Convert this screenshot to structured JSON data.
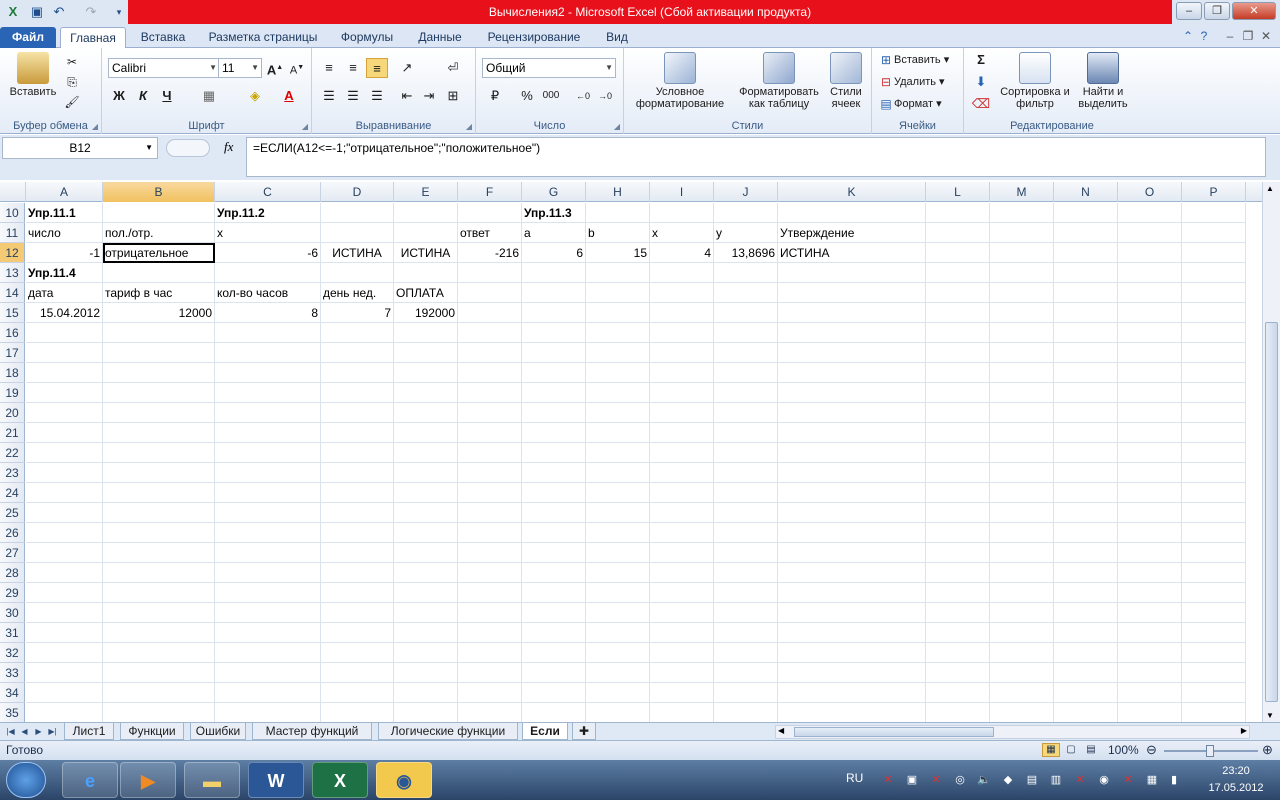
{
  "window": {
    "title": "Вычисления2 - Microsoft Excel (Сбой активации продукта)"
  },
  "ribbon_tabs": [
    "Файл",
    "Главная",
    "Вставка",
    "Разметка страницы",
    "Формулы",
    "Данные",
    "Рецензирование",
    "Вид"
  ],
  "ribbon": {
    "clipboard": {
      "paste": "Вставить",
      "label": "Буфер обмена"
    },
    "font": {
      "name": "Calibri",
      "size": "11",
      "label": "Шрифт",
      "bold": "Ж",
      "italic": "К",
      "underline": "Ч"
    },
    "alignment": {
      "label": "Выравнивание"
    },
    "number": {
      "format": "Общий",
      "label": "Число",
      "percent": "%",
      "thousands": "000"
    },
    "styles": {
      "conditional": "Условное форматирование",
      "table": "Форматировать как таблицу",
      "cell_styles": "Стили ячеек",
      "label": "Стили"
    },
    "cells": {
      "insert": "Вставить",
      "delete": "Удалить",
      "format": "Формат",
      "label": "Ячейки"
    },
    "editing": {
      "sort": "Сортировка и фильтр",
      "find": "Найти и выделить",
      "label": "Редактирование"
    }
  },
  "formula_bar": {
    "name_box": "B12",
    "fx": "fx",
    "formula": "=ЕСЛИ(A12<=-1;\"отрицательное\";\"положительное\")"
  },
  "columns": [
    "A",
    "B",
    "C",
    "D",
    "E",
    "F",
    "G",
    "H",
    "I",
    "J",
    "K",
    "L",
    "M",
    "N",
    "O",
    "P"
  ],
  "rows": {
    "r10": {
      "num": "10",
      "A": "Упр.11.1",
      "C": "Упр.11.2",
      "G": "Упр.11.3"
    },
    "r11": {
      "num": "11",
      "A": "число",
      "B": "пол./отр.",
      "C": "x",
      "F": "ответ",
      "G": "a",
      "H": "b",
      "I": "x",
      "J": "y",
      "K": "Утверждение"
    },
    "r12": {
      "num": "12",
      "A": "-1",
      "B": "отрицательное",
      "C": "-6",
      "D": "ИСТИНА",
      "E": "ИСТИНА",
      "F": "-216",
      "G": "6",
      "H": "15",
      "I": "4",
      "J": "13,8696",
      "K": "ИСТИНА"
    },
    "r13": {
      "num": "13",
      "A": "Упр.11.4"
    },
    "r14": {
      "num": "14",
      "A": "дата",
      "B": "тариф в час",
      "C": "кол-во часов",
      "D": "день нед.",
      "E": "ОПЛАТА"
    },
    "r15": {
      "num": "15",
      "A": "15.04.2012",
      "B": "12000",
      "C": "8",
      "D": "7",
      "E": "192000"
    },
    "empty": [
      "16",
      "17",
      "18",
      "19",
      "20",
      "21",
      "22",
      "23",
      "24",
      "25",
      "26",
      "27",
      "28",
      "29",
      "30",
      "31",
      "32",
      "33",
      "34",
      "35"
    ]
  },
  "sheets": [
    "Лист1",
    "Функции",
    "Ошибки",
    "Мастер функций",
    "Логические функции",
    "Если"
  ],
  "status": {
    "ready": "Готово",
    "zoom": "100%"
  },
  "taskbar": {
    "lang": "RU",
    "time": "23:20",
    "date": "17.05.2012"
  }
}
